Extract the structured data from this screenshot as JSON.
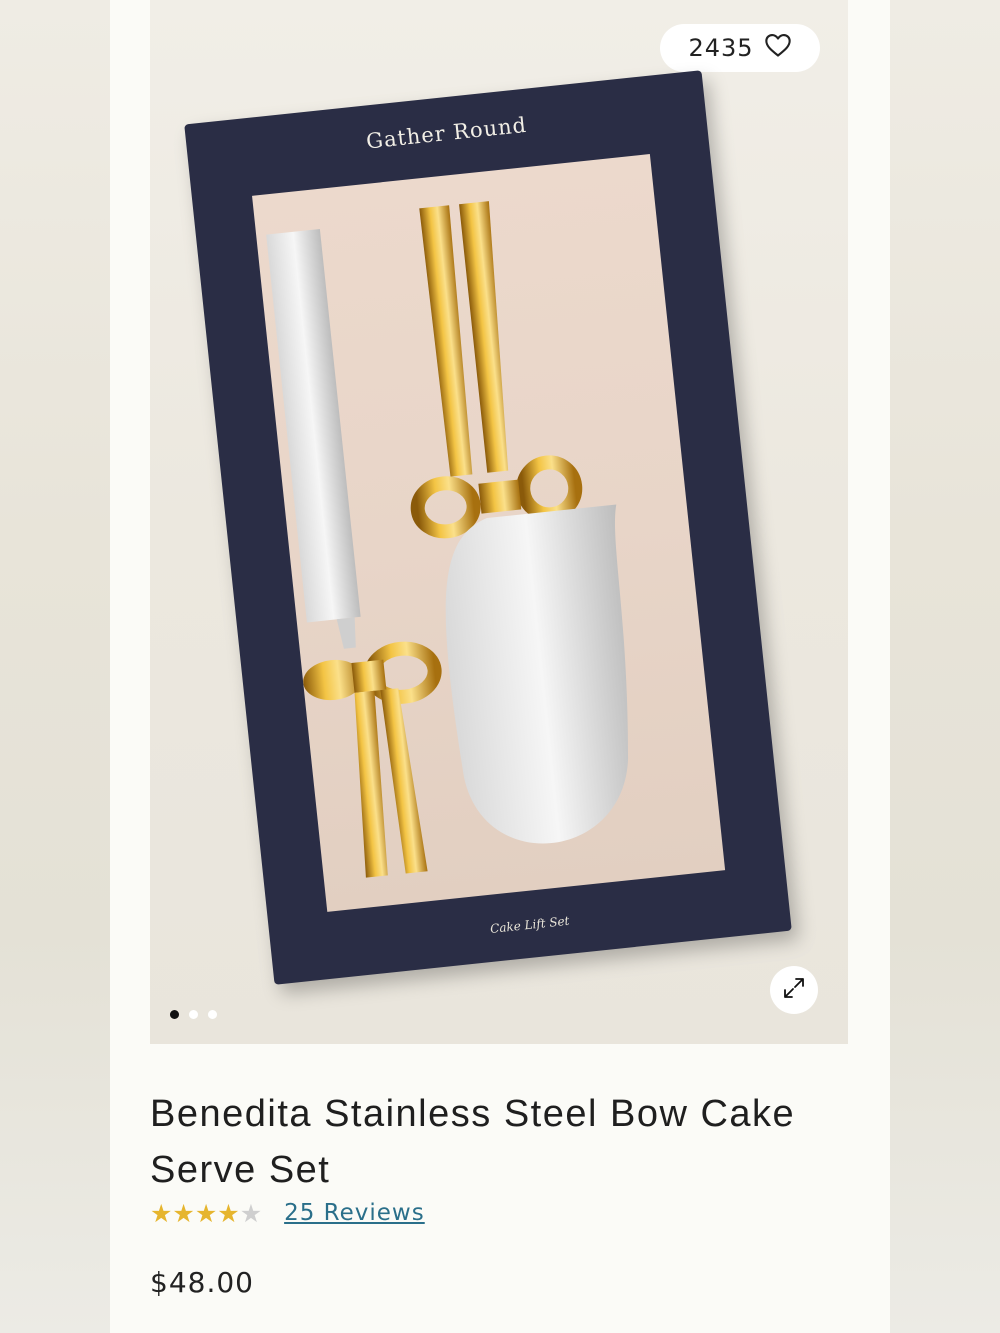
{
  "product": {
    "like_count": "2435",
    "box_brand": "Gather Round",
    "box_caption": "Cake Lift Set",
    "title": "Benedita Stainless Steel Bow Cake Serve Set",
    "rating": 4,
    "rating_max": 5,
    "reviews_label": "25 Reviews",
    "price": "$48.00"
  },
  "carousel": {
    "total_images": 3,
    "active_index": 0
  },
  "icons": {
    "like": "heart-outline-icon",
    "expand": "expand-arrows-icon"
  },
  "colors": {
    "star": "#e6b52e",
    "link": "#2a6f8a",
    "box": "#2a2d45"
  }
}
